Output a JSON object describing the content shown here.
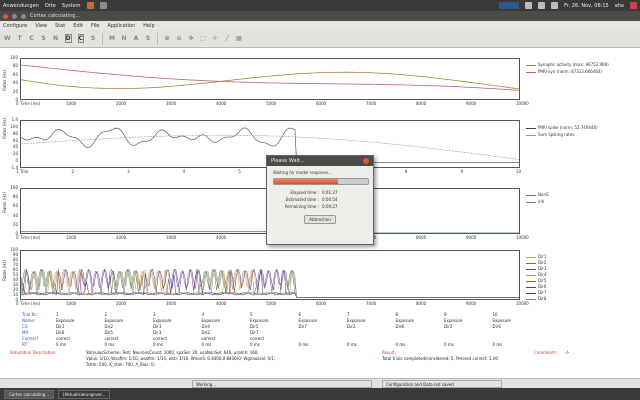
{
  "topbar": {
    "menus": [
      "Anwendungen",
      "Orte",
      "System"
    ],
    "clock": "Fr, 26. Nov, 08:15",
    "user": "aha"
  },
  "window": {
    "title": "Cortex calculating..."
  },
  "menubar": [
    "Configure",
    "View",
    "Stat",
    "Edit",
    "File",
    "Application",
    "Help"
  ],
  "toolbar": [
    "W",
    "T",
    "C",
    "S",
    "N",
    "D",
    "C",
    "S",
    "M",
    "N",
    "A",
    "S"
  ],
  "colors": {
    "plot1_a": "#9b8a3a",
    "plot1_b": "#c05a8a",
    "plot2_a": "#444444",
    "plot2_b": "#999999",
    "plot3_a": "#4a8a4a",
    "raster_colors": [
      "#e89a3a",
      "#3a8a3a",
      "#7a3a9a",
      "#c89a5a",
      "#9a6a3a",
      "#5a3a8a",
      "#3a3a8a",
      "#8a8a8a"
    ],
    "progress": "#e06a44"
  },
  "plots": {
    "p1": {
      "ylabel": "Rates (Hz)",
      "yticks": [
        "100",
        "80",
        "60",
        "40",
        "20",
        "0"
      ],
      "xlabel": "Time (ms)",
      "xticks": [
        "0",
        "1000",
        "2000",
        "3000",
        "4000",
        "5000",
        "6000",
        "7000",
        "8000",
        "9000",
        "10000"
      ],
      "legend": [
        "Synaptic activity (max: 96753.969)",
        "fMRI-syn (norm: 87312.666464)"
      ]
    },
    "p2": {
      "ylabel": "Rates (Hz)",
      "yticks": [
        "1.4",
        "100",
        "80",
        "60",
        "40",
        "20",
        "0",
        "-1.4"
      ],
      "xlabel": "Trial",
      "xticks": [
        "1",
        "2",
        "3",
        "4",
        "5",
        "6",
        "7",
        "8",
        "9",
        "10"
      ],
      "legend": [
        "fMRI spike (norm: 52.749446)",
        "Sum Spiking rates"
      ]
    },
    "p3": {
      "ylabel": "Rates (Hz)",
      "yticks": [
        "100",
        "80",
        "60",
        "40",
        "20",
        "0"
      ],
      "xlabel": "Time (ms)",
      "xticks": [
        "0",
        "1000",
        "2000",
        "3000",
        "4000",
        "5000",
        "6000",
        "7000",
        "8000",
        "9000",
        "10000"
      ],
      "legend": [
        "NonS",
        "inh"
      ]
    },
    "p4": {
      "ylabel": "Rates (Hz)",
      "yticks": [
        "100",
        "90",
        "80",
        "70",
        "60",
        "50",
        "40",
        "30",
        "20",
        "10",
        "0"
      ],
      "xlabel": "Time (ms)",
      "xticks": [
        "0",
        "1000",
        "2000",
        "3000",
        "4000",
        "5000",
        "6000",
        "7000",
        "8000",
        "9000",
        "10000"
      ],
      "legend": [
        "Dir1",
        "Dir2",
        "Dir3",
        "Dir4",
        "Dir5",
        "Dir6",
        "Dir7",
        "Dir8"
      ]
    }
  },
  "info": {
    "row_labels": [
      "Trial Nr.:",
      "Name:",
      "CS:",
      "MR:",
      "Correct?",
      "RT:"
    ],
    "columns": [
      {
        "n": "1",
        "name": "Exposure",
        "cs": "Dir1",
        "mr": "Dir8",
        "correct": "correct",
        "rt": "0 ms"
      },
      {
        "n": "2",
        "name": "Exposure",
        "cs": "Dir2",
        "mr": "Dir5",
        "correct": "correct",
        "rt": "0 ms"
      },
      {
        "n": "3",
        "name": "Exposure",
        "cs": "Dir3",
        "mr": "Dir3",
        "correct": "correct",
        "rt": "0 ms"
      },
      {
        "n": "4",
        "name": "Exposure",
        "cs": "Dir4",
        "mr": "Dir2",
        "correct": "correct",
        "rt": "0 ms"
      },
      {
        "n": "5",
        "name": "Exposure",
        "cs": "Dir5",
        "mr": "Dir7",
        "correct": "correct",
        "rt": "0 ms"
      },
      {
        "n": "6",
        "name": "Exposure",
        "cs": "Dir7",
        "mr": "",
        "correct": "",
        "rt": "0 ms"
      },
      {
        "n": "7",
        "name": "Exposure",
        "cs": "Dir2",
        "mr": "",
        "correct": "",
        "rt": "0 ms"
      },
      {
        "n": "8",
        "name": "Exposure",
        "cs": "Dir8",
        "mr": "",
        "correct": "",
        "rt": "0 ms"
      },
      {
        "n": "9",
        "name": "Exposure",
        "cs": "Dir2",
        "mr": "",
        "correct": "",
        "rt": "0 ms"
      },
      {
        "n": "10",
        "name": "Exposure",
        "cs": "Dir6",
        "mr": "",
        "correct": "",
        "rt": "0 ms"
      }
    ],
    "sim_label": "Simulation Description:",
    "sim_text1": "StimulusScheme: Test; NeuronsCount: 1000, spaSel: 20, usaNonSel: 640, usaInh: 160;",
    "sim_text2": "Vplus: 1/10, Wsaflm: 1/10, wsaflm: 1/10, wsti: 1/16, WnonS: 0.4400,0.8400(0; Wgnaukral: 0/1;",
    "sim_text3": "Tstim: 500, K_stim: 700, A_Bias: 0;",
    "result_label": "Result:",
    "result_text": "Total trials completed/considered: 5, Percent correct: 1.00",
    "comments_label": "Comments:",
    "comments_text": "-/-"
  },
  "dialog": {
    "title": "Please Wait...",
    "message": "Waiting for model response...",
    "progress": 0.68,
    "rows": [
      {
        "k": "Elapsed time :",
        "v": "0:01:27"
      },
      {
        "k": "Estimated time :",
        "v": "0:00:54"
      },
      {
        "k": "Remaining time :",
        "v": "0:00:27"
      }
    ],
    "button": "Abbrechen"
  },
  "status": {
    "left": "Working...",
    "right": "Configuration and Data not saved"
  },
  "taskbar": [
    "Cortex calculating...",
    "[Aktualisierungsver..."
  ]
}
